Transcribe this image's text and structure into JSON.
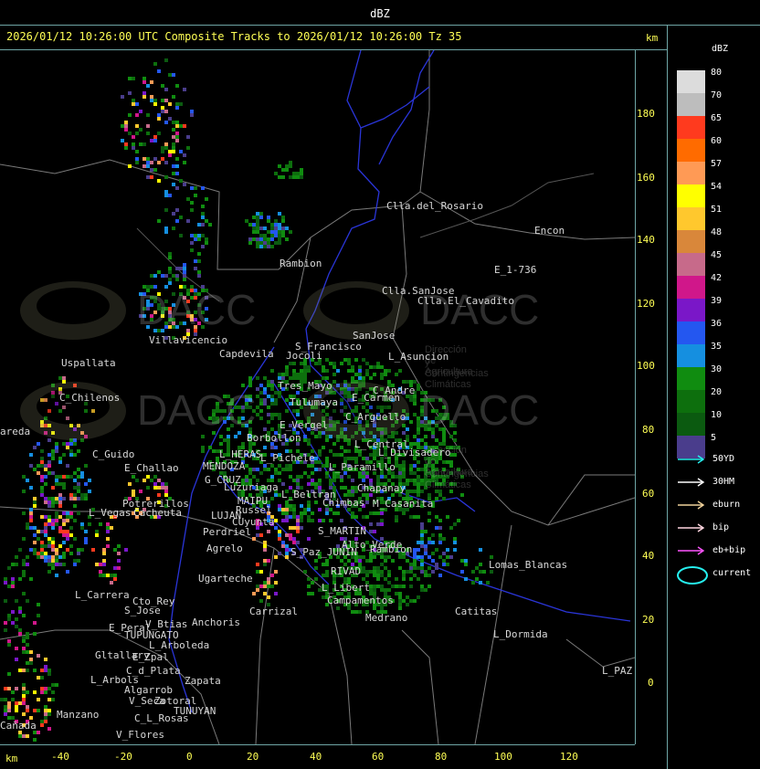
{
  "top_label": "dBZ",
  "header": {
    "title": "2026/01/12 10:26:00 UTC Composite Tracks to 2026/01/12 10:26:00 Tz 35",
    "km_label": "km"
  },
  "axes": {
    "y_ticks": [
      "180",
      "160",
      "140",
      "120",
      "100",
      "80",
      "60",
      "40",
      "20",
      "0"
    ],
    "x_ticks": [
      "-40",
      "-20",
      "0",
      "20",
      "40",
      "60",
      "80",
      "100",
      "120"
    ],
    "bottom_km": "km"
  },
  "legend": {
    "title": "dBZ",
    "levels": [
      {
        "label": "80",
        "color": "#dcdcdc"
      },
      {
        "label": "70",
        "color": "#bdbdbd"
      },
      {
        "label": "65",
        "color": "#ff3a1e"
      },
      {
        "label": "60",
        "color": "#ff6b00"
      },
      {
        "label": "57",
        "color": "#ff9a55"
      },
      {
        "label": "54",
        "color": "#ffff00"
      },
      {
        "label": "51",
        "color": "#ffc82d"
      },
      {
        "label": "48",
        "color": "#d9873a"
      },
      {
        "label": "45",
        "color": "#c76a8a"
      },
      {
        "label": "42",
        "color": "#d0178a"
      },
      {
        "label": "39",
        "color": "#7a17c8"
      },
      {
        "label": "36",
        "color": "#2457f0"
      },
      {
        "label": "35",
        "color": "#158fe0"
      },
      {
        "label": "30",
        "color": "#108c10"
      },
      {
        "label": "20",
        "color": "#0d6f0d"
      },
      {
        "label": "10",
        "color": "#0b5a10"
      },
      {
        "label": "5",
        "color": "#4a3d8c"
      }
    ],
    "tracks": [
      {
        "label": "50YD",
        "color": "#26f0f0"
      },
      {
        "label": "30HM",
        "color": "#ffffff"
      },
      {
        "label": "eburn",
        "color": "#f0d29a"
      },
      {
        "label": "bip",
        "color": "#ffd6e0"
      },
      {
        "label": "eb+bip",
        "color": "#ff55ff"
      }
    ],
    "current": {
      "label": "current",
      "color": "#26f0f0"
    }
  },
  "watermark": {
    "name": "DACC",
    "subtitle_1": "Dirección de Agricultura",
    "subtitle_2": "y Contingencias Climáticas"
  },
  "places": [
    "Clla.del_Rosario",
    "Encon",
    "E_1-736",
    "Rambion",
    "Clla.SanJose",
    "Clla.El_Cavadito",
    "Villavicencio",
    "Capdevila",
    "S_Francisco",
    "SanJose",
    "L_Asuncion",
    "Uspallata",
    "C_Chilenos",
    "Jocoli",
    "Tres_Mayo",
    "Tulumaya",
    "E_Carmen",
    "C_Andre",
    "areda",
    "Borbollon",
    "E_Vergel",
    "C_Arguello",
    "L_Central",
    "L_Divisadero",
    "C_Guido",
    "E_Challao",
    "MENDOZA",
    "G_CRUZ",
    "L_HERAS",
    "L_Pichele",
    "L_Paramillo",
    "Luzuriaga",
    "L_Beltran",
    "Chimbas",
    "Chapanay",
    "M_Casanita",
    "Potrerillos",
    "L_Vegas",
    "Cacheuta",
    "MAIPU",
    "Russel",
    "LUJAN",
    "CUyunta",
    "Perdriel",
    "Agrelo",
    "S_MARTIN",
    "Alto_Verde",
    "Rambion",
    "S_Paz_JUNIN",
    "RIVAD",
    "Lomas_Blancas",
    "Ugarteche",
    "L_Libert",
    "Campamentos",
    "Carrizal",
    "Medrano",
    "L_Carrera",
    "Cto_Rey",
    "S_Jose",
    "Catitas",
    "E_Peral",
    "TUPUNGATO",
    "V_Btias",
    "Anchoris",
    "L_Dormida",
    "L_Arboleda",
    "Gltallary",
    "E_Zpal",
    "C_d_Plata",
    "L_Arbols",
    "Zapata",
    "Algarrob",
    "V_Seca",
    "Zotoral",
    "TUNUYAN",
    "L_PAZ",
    "Manzano",
    "C_L_Rosas",
    "V_Flores",
    "Cañada"
  ]
}
